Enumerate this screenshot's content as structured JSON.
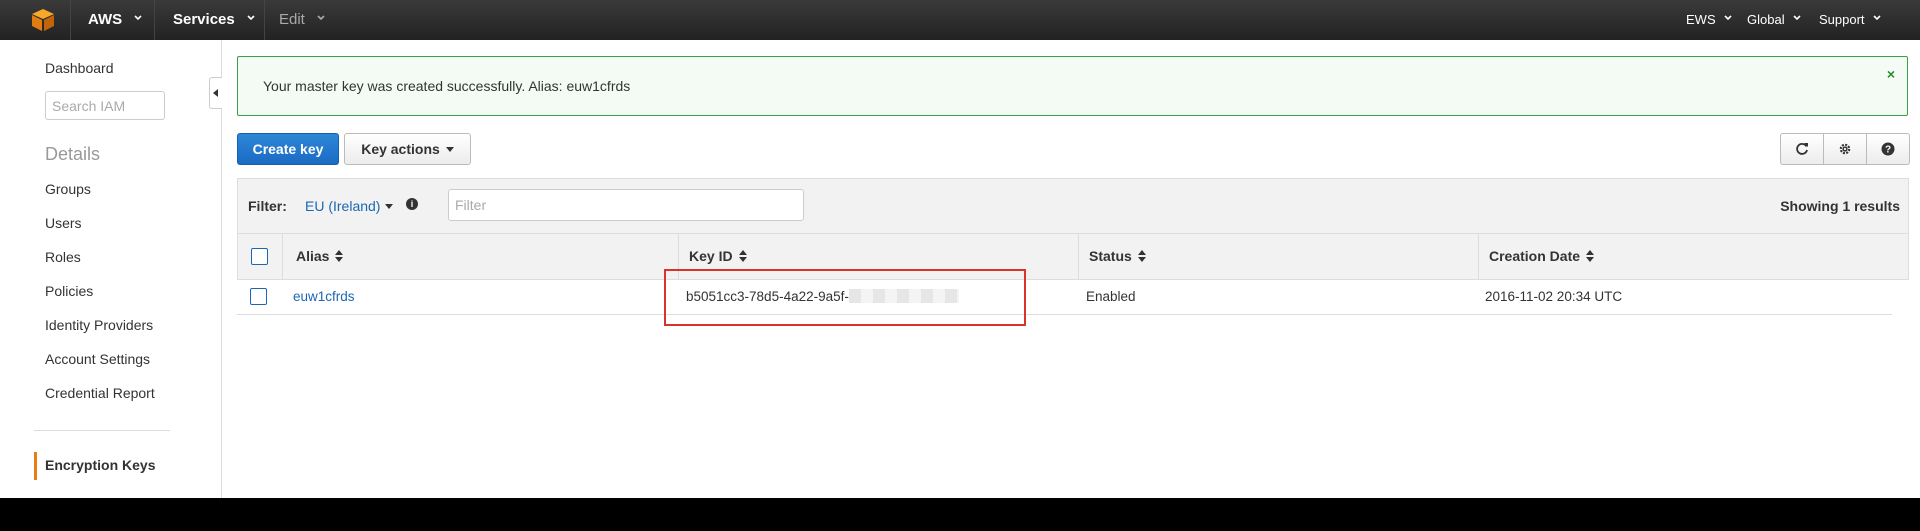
{
  "topnav": {
    "brand": "AWS",
    "services": "Services",
    "edit": "Edit",
    "account": "EWS",
    "region": "Global",
    "support": "Support"
  },
  "sidebar": {
    "dashboard": "Dashboard",
    "search_placeholder": "Search IAM",
    "section_title": "Details",
    "items": [
      "Groups",
      "Users",
      "Roles",
      "Policies",
      "Identity Providers",
      "Account Settings",
      "Credential Report"
    ],
    "active_item": "Encryption Keys"
  },
  "alert": {
    "message": "Your master key was created successfully. Alias: euw1cfrds",
    "close": "×"
  },
  "toolbar": {
    "create_key": "Create key",
    "key_actions": "Key actions",
    "icons": [
      "refresh-icon",
      "gear-icon",
      "help-icon"
    ]
  },
  "filter": {
    "label": "Filter:",
    "region": "EU (Ireland)",
    "input_placeholder": "Filter",
    "results": "Showing 1 results"
  },
  "table": {
    "columns": [
      "Alias",
      "Key ID",
      "Status",
      "Creation Date"
    ],
    "rows": [
      {
        "alias": "euw1cfrds",
        "key_id": "b5051cc3-78d5-4a22-9a5f-",
        "status": "Enabled",
        "creation_date": "2016-11-02 20:34 UTC"
      }
    ]
  },
  "colors": {
    "topnav_bg": "#232323",
    "primary_button": "#1a6bc4",
    "link": "#1b67b3",
    "success_border": "#3c9e45",
    "highlight_box": "#d9342b",
    "active_indicator": "#e57f16"
  }
}
